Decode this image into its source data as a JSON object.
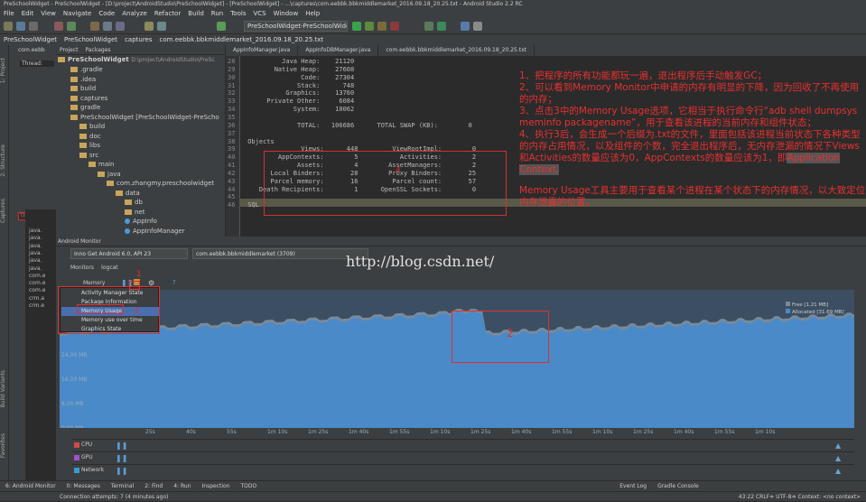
{
  "window": {
    "title": "PreSchoolWidget - PreSchoolWidget - [D:\\project\\AndroidStudio\\PreSchoolWidget] - [PreSchoolWidget] - ...\\captures\\com.eebbk.bbkmiddlemarket_2016.09.18_20.25.txt - Android Studio 2.2 RC"
  },
  "menu": [
    "File",
    "Edit",
    "View",
    "Navigate",
    "Code",
    "Analyze",
    "Refactor",
    "Build",
    "Run",
    "Tools",
    "VCS",
    "Window",
    "Help"
  ],
  "toolbar": {
    "run_config": "PreSchoolWidget-PreSchoolWidget"
  },
  "navbar": [
    "PreSchoolWidget",
    "PreSchoolWidget",
    "captures",
    "com.eebbk.bbkmiddlemarket_2016.09.18_20.25.txt"
  ],
  "side_labels": [
    "1: Project",
    "2: Structure",
    "Captures",
    "Build Variants",
    "Favorites"
  ],
  "bg_panel": {
    "left_tab": "com.eebb",
    "thread": "Thread:",
    "thread_main": "Thread-m"
  },
  "ddms_lines": [
    "java.",
    "java.",
    "java.",
    "java.",
    "java.",
    "java.",
    "com.e",
    "com.e",
    "com.e",
    "crm.a",
    "crm.e"
  ],
  "project": {
    "tabs": [
      "Project",
      "Packages"
    ],
    "root": "PreSchoolWidget",
    "root_path": "D:\\project\\AndroidStudio\\PreSc",
    "items": [
      ".gradle",
      ".idea",
      "build",
      "captures",
      "gradle",
      "PreSchoolWidget [PreSchoolWidget-PreScho",
      "build",
      "doc",
      "libs",
      "src",
      "main",
      "java",
      "com.zhangmy.preschoolwidget",
      "data",
      "db",
      "net",
      "AppInfo",
      "AppInfoManager"
    ]
  },
  "editor": {
    "tabs": [
      "AppInfoManager.java",
      "AppInfoDBManager.java",
      "com.eebbk.bbkmiddlemarket_2016.09.18_20.25.txt"
    ],
    "lines": [
      {
        "n": "28",
        "t": "          Java Heap:    21120"
      },
      {
        "n": "29",
        "t": "        Native Heap:    27608"
      },
      {
        "n": "30",
        "t": "               Code:    27304"
      },
      {
        "n": "31",
        "t": "              Stack:      748"
      },
      {
        "n": "32",
        "t": "           Graphics:    13760"
      },
      {
        "n": "33",
        "t": "      Private Other:     6084"
      },
      {
        "n": "34",
        "t": "             System:    10062"
      },
      {
        "n": "35",
        "t": ""
      },
      {
        "n": "36",
        "t": "              TOTAL:   106686      TOTAL SWAP (KB):        0"
      },
      {
        "n": "37",
        "t": ""
      },
      {
        "n": "38",
        "t": " Objects"
      },
      {
        "n": "39",
        "t": "               Views:      448         ViewRootImpl:        0"
      },
      {
        "n": "40",
        "t": "         AppContexts:        5           Activities:        2"
      },
      {
        "n": "41",
        "t": "              Assets:        4        AssetManagers:        2"
      },
      {
        "n": "42",
        "t": "       Local Binders:       28        Proxy Binders:       25"
      },
      {
        "n": "43",
        "t": "       Parcel memory:       16         Parcel count:       57"
      },
      {
        "n": "44",
        "t": "    Death Recipients:        1      OpenSSL Sockets:        0"
      },
      {
        "n": "45",
        "t": ""
      },
      {
        "n": "46",
        "t": " SQL"
      }
    ]
  },
  "annotation": {
    "p1": "1、把程序的所有功能都玩一遍，退出程序后手动触发GC；",
    "p2": "2、可以看到Memory Monitor中申请的内存有明显的下降，因为回收了不再使用的内存；",
    "p3": "3、点击3中的Memory Usage选项，它相当于执行命令行“adb shell dumpsys meminfo packagename”，用于查看该进程的当前内存和组件状态；",
    "p4a": "4、执行3后，会生成一个后缀为.txt的文件，里面包括该进程当前状态下各种类型的内存占用情况，以及组件的个数，完全退出程序后，无内存泄漏的情况下Views和Activities的数量应该为0，AppContexts的数量应该为1，即",
    "p4b": "Application Context.",
    "p5": "Memory Usage工具主要用于查看某个进程在某个状态下的内存情况，以大致定位内存泄露的位置。"
  },
  "markers": [
    "1",
    "2",
    "3",
    "4"
  ],
  "monitor": {
    "title": "Android Monitor",
    "device": "Inno Get  Android 6.0, API 23",
    "process": "com.eebbk.bbkmiddlemarket (3709)",
    "tabs": [
      "Monitors",
      "logcat"
    ],
    "mem_label": "Memory",
    "popup_items": [
      "Activity Manager State",
      "Package Information",
      "Memory Usage",
      "Memory use over time",
      "Graphics State"
    ],
    "y_ticks": [
      "32.00 MB",
      "24.00 MB",
      "16.00 MB",
      "8.00 MB",
      "0.00 MB"
    ],
    "x_ticks": [
      "25s",
      "40s",
      "55s",
      "1m 10s",
      "1m 25s",
      "1m 40s",
      "1m 55s",
      "1m 10s",
      "1m 25s",
      "1m 40s",
      "1m 55s",
      "1m 10s",
      "1m 25s",
      "1m 40s",
      "1m 55s",
      "1m 10s"
    ],
    "legend": [
      {
        "label": "Free [1.21 MB]",
        "color": "#7a8a9a"
      },
      {
        "label": "Allocated [31.69 MB]",
        "color": "#4a8ac8"
      }
    ],
    "rows": [
      "CPU",
      "GPU",
      "Network"
    ]
  },
  "bottom_tabs": [
    "6: Android Monitor",
    "0: Messages",
    "Terminal",
    "2: Find",
    "4: Run",
    "Inspection",
    "TODO",
    "Event Log",
    "Gradle Console"
  ],
  "status": {
    "left": "Connection attempts: 7 (4 minutes ago)",
    "right": "43:22  CRLF≑  UTF-8≑  Context: <no context>"
  },
  "watermark": "http://blog.csdn.net/",
  "colors": {
    "annotation": "#e83030",
    "chart_fill": "#4a8ac8",
    "chart_bg": "#3c4f62"
  }
}
